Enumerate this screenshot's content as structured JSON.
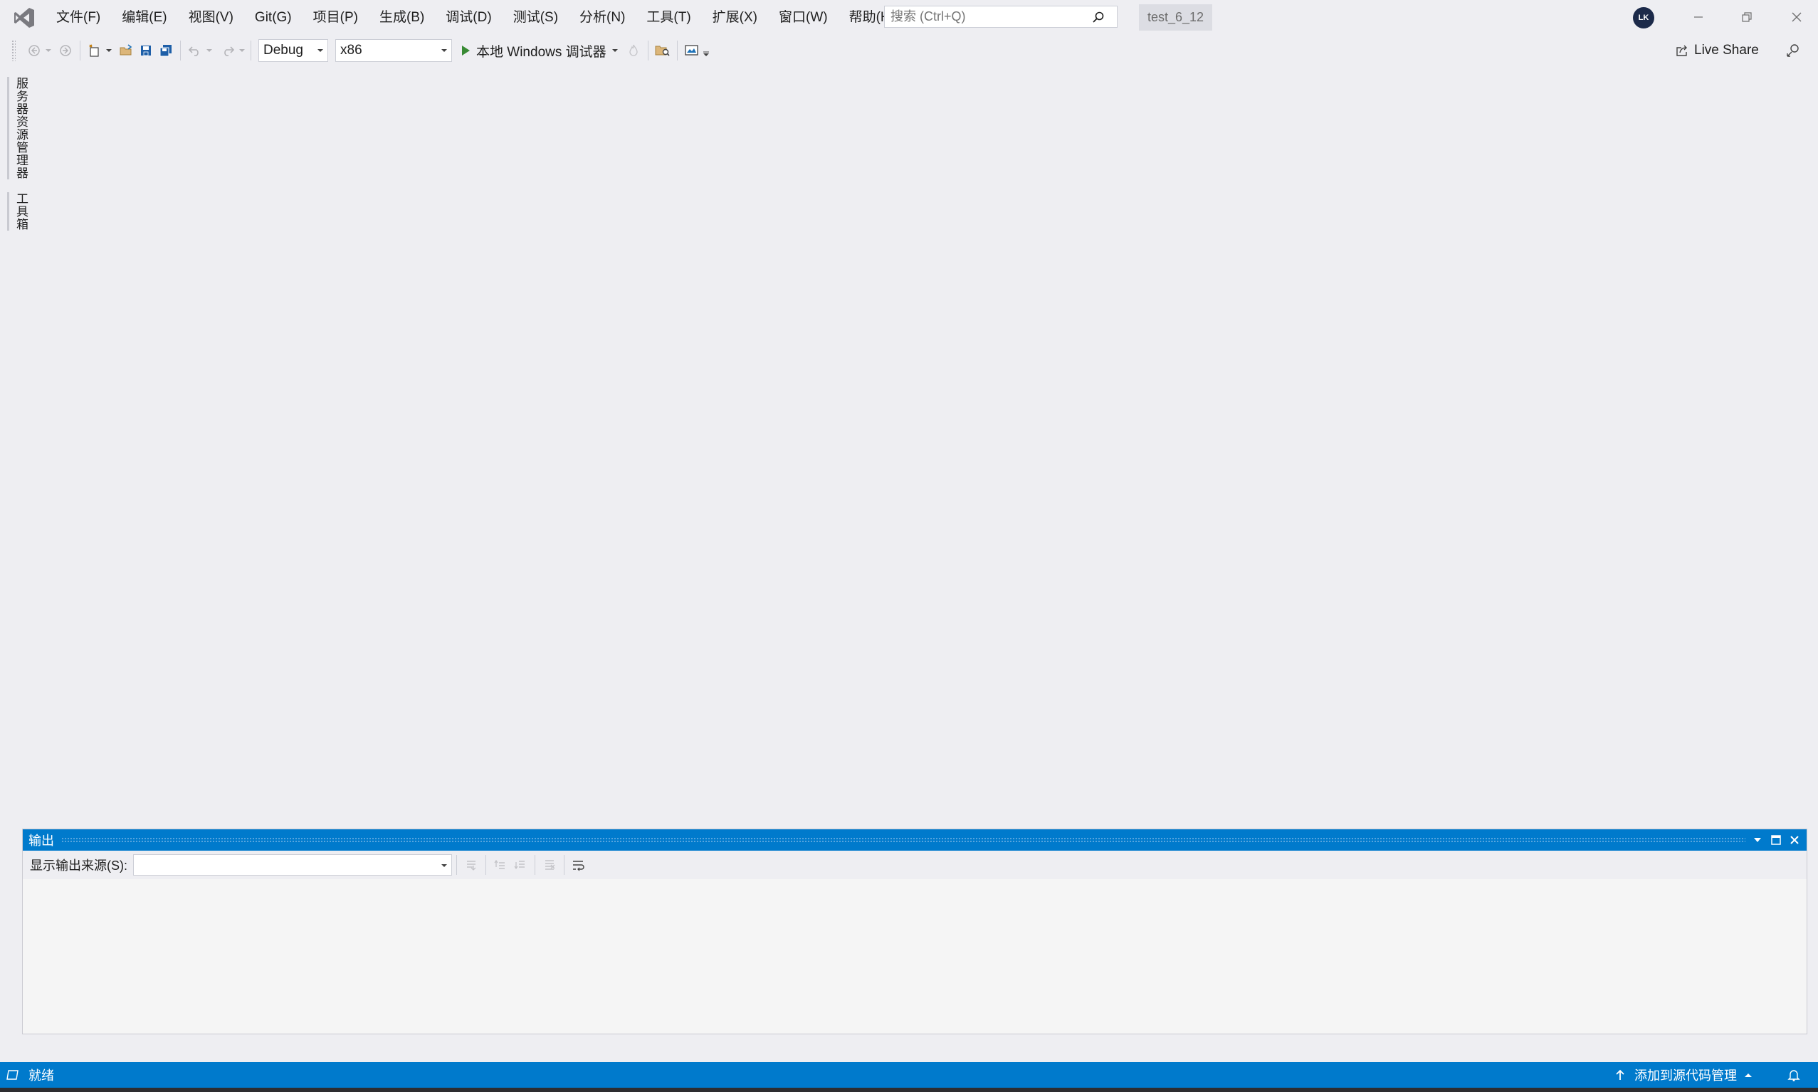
{
  "titlebar": {
    "menu": [
      "文件(F)",
      "编辑(E)",
      "视图(V)",
      "Git(G)",
      "项目(P)",
      "生成(B)",
      "调试(D)",
      "测试(S)",
      "分析(N)",
      "工具(T)",
      "扩展(X)",
      "窗口(W)",
      "帮助(H)"
    ],
    "search_placeholder": "搜索 (Ctrl+Q)",
    "solution_name": "test_6_12",
    "account_initials": "LK"
  },
  "toolbar": {
    "config": "Debug",
    "platform": "x86",
    "run_label": "本地 Windows 调试器",
    "live_share": "Live Share"
  },
  "side_tabs": [
    "服务器资源管理器",
    "工具箱"
  ],
  "output": {
    "title": "输出",
    "source_label": "显示输出来源(S):",
    "source_value": ""
  },
  "statusbar": {
    "status": "就绪",
    "source_control": "添加到源代码管理"
  },
  "colors": {
    "accent": "#007acc",
    "background": "#eeeef2",
    "run_green": "#388a34"
  },
  "icons": [
    "vs-logo-icon",
    "search-icon",
    "minimize-icon",
    "restore-icon",
    "close-icon",
    "back-icon",
    "forward-icon",
    "new-project-icon",
    "open-icon",
    "save-icon",
    "save-all-icon",
    "undo-icon",
    "redo-icon",
    "play-icon",
    "hot-reload-icon",
    "find-in-files-icon",
    "screenshot-icon",
    "live-share-icon",
    "feedback-icon",
    "up-arrow-icon",
    "bell-icon"
  ]
}
